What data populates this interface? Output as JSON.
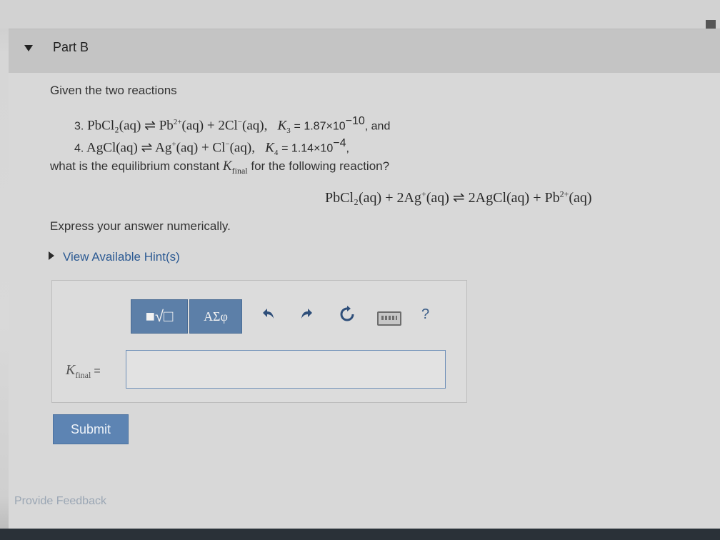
{
  "part": {
    "title": "Part B"
  },
  "problem": {
    "intro": "Given the two reactions",
    "reaction3": {
      "num": "3.",
      "lhs": "PbCl₂(aq) ⇌ Pb",
      "sup1": "2+",
      "mid": "(aq) + 2Cl",
      "sup2": "−",
      "rhs": "(aq),",
      "k_symbol": "K",
      "k_sub": "3",
      "k_value": "= 1.87×10",
      "k_exp": "−10",
      "tail": ", and"
    },
    "reaction4": {
      "num": "4.",
      "lhs": "AgCl(aq) ⇌ Ag",
      "sup1": "+",
      "mid": "(aq) + Cl",
      "sup2": "−",
      "rhs": "(aq),",
      "k_symbol": "K",
      "k_sub": "4",
      "k_value": "= 1.14×10",
      "k_exp": "−4",
      "tail": ","
    },
    "question_pre": "what is the equilibrium constant",
    "question_k": "K",
    "question_k_sub": "final",
    "question_post": "for the following reaction?",
    "main_reaction": {
      "part1": "PbCl₂(aq) + 2Ag",
      "sup1": "+",
      "part2": "(aq) ⇌ 2AgCl(aq) + Pb",
      "sup2": "2+",
      "part3": "(aq)"
    },
    "express": "Express your answer numerically.",
    "hint_link": "View Available Hint(s)"
  },
  "toolbar": {
    "templates_label": "■√□",
    "greek_label": "ΑΣφ",
    "undo_icon": "undo-icon",
    "redo_icon": "redo-icon",
    "reset_icon": "reset-icon",
    "keyboard_icon": "keyboard-icon",
    "help_label": "?"
  },
  "answer": {
    "label_k": "K",
    "label_sub": "final",
    "label_eq": "=",
    "value": ""
  },
  "submit_label": "Submit",
  "feedback_link": "Provide Feedback",
  "colors": {
    "accent": "#5c7fa8",
    "link": "#2c5a93"
  }
}
